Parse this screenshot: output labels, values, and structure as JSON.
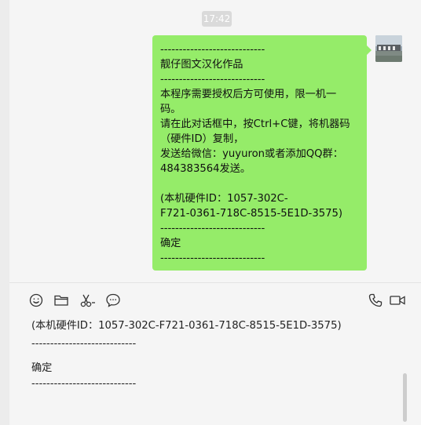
{
  "chat": {
    "timestamp": "17:42",
    "message_lines": [
      "----------------------------",
      "靓仔图文汉化作品",
      "----------------------------",
      "本程序需要授权后方可使用，限一机一",
      "码。",
      "请在此对话框中，按Ctrl+C键，将机器码",
      "（硬件ID）复制，",
      "发送给微信：yuyuron或者添加QQ群：",
      "484383564发送。",
      "",
      "(本机硬件ID：1057-302C-",
      "F721-0361-718C-8515-5E1D-3575)",
      "----------------------------",
      "确定",
      "----------------------------"
    ]
  },
  "toolbar": {
    "left_icons": [
      "emoji-icon",
      "folder-icon",
      "scissors-icon",
      "chat-history-icon"
    ],
    "right_icons": [
      "phone-icon",
      "video-icon"
    ]
  },
  "input_box": {
    "lines": [
      "(本机硬件ID：1057-302C-F721-0361-718C-8515-5E1D-3575)",
      "----------------------------",
      "确定",
      "----------------------------"
    ]
  },
  "colors": {
    "bubble": "#95ec69",
    "background": "#f5f5f5",
    "timestamp_pill": "#dadada"
  }
}
